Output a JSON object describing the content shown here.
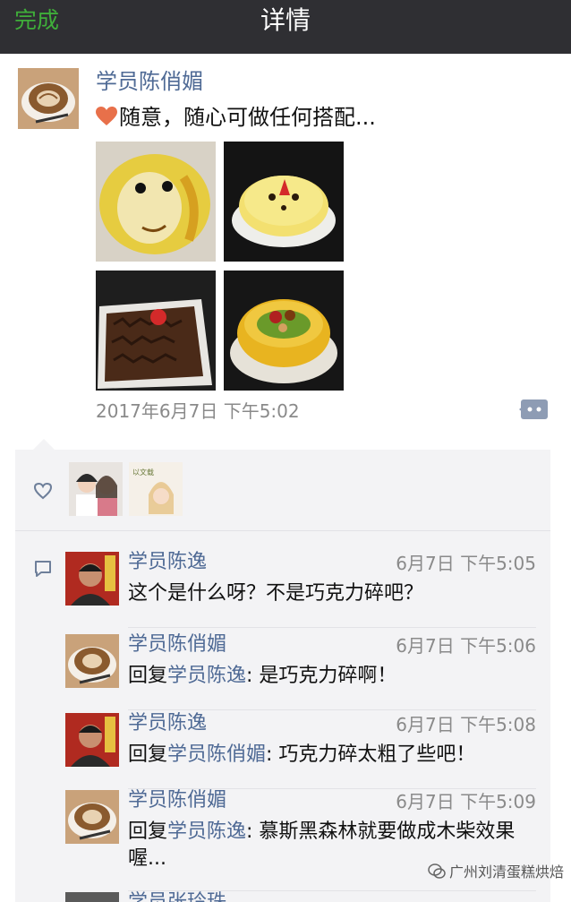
{
  "nav": {
    "left_label": "完成",
    "title": "详情"
  },
  "post": {
    "author": "学员陈俏媚",
    "text": "随意，随心可做任何搭配...",
    "time": "2017年6月7日 下午5:02",
    "photos": [
      "face-cake-icon",
      "strawberry-cream-cake-icon",
      "chocolate-flake-cake-icon",
      "kiwi-fruit-cake-icon"
    ]
  },
  "comments": [
    {
      "name": "学员陈逸",
      "time": "6月7日 下午5:05",
      "prefix": "",
      "target": "",
      "body": "这个是什么呀？不是巧克力碎吧？",
      "avatar": "man-avatar"
    },
    {
      "name": "学员陈俏媚",
      "time": "6月7日 下午5:06",
      "prefix": "回复",
      "target": "学员陈逸",
      "body": ": 是巧克力碎啊！",
      "avatar": "latte-avatar"
    },
    {
      "name": "学员陈逸",
      "time": "6月7日 下午5:08",
      "prefix": "回复",
      "target": "学员陈俏媚",
      "body": ": 巧克力碎太粗了些吧！",
      "avatar": "man-avatar"
    },
    {
      "name": "学员陈俏媚",
      "time": "6月7日 下午5:09",
      "prefix": "回复",
      "target": "学员陈逸",
      "body": ": 慕斯黑森林就要做成木柴效果喔...",
      "avatar": "latte-avatar"
    },
    {
      "name": "学员张玲珠",
      "time": "",
      "prefix": "",
      "target": "",
      "body": "",
      "avatar": "man-avatar"
    }
  ],
  "watermark": "广州刘清蛋糕烘焙",
  "colors": {
    "nav_bg": "#2f2f33",
    "nav_green": "#3fae3a",
    "name_blue": "#4f6a95",
    "panel_bg": "#f3f3f5"
  }
}
